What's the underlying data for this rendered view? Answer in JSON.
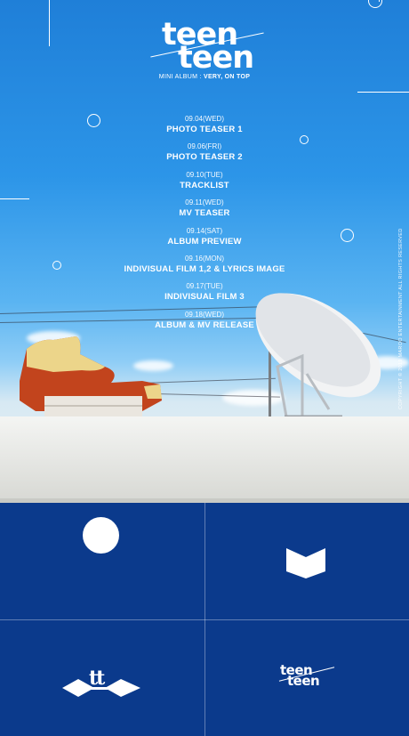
{
  "logo": {
    "line1": "teen",
    "line2": "teen"
  },
  "album": {
    "prefix": "MINI ALBUM : ",
    "title": "VERY, ON TOP"
  },
  "schedule": [
    {
      "date": "09.04(WED)",
      "title": "PHOTO TEASER 1"
    },
    {
      "date": "09.06(FRI)",
      "title": "PHOTO TEASER 2"
    },
    {
      "date": "09.10(TUE)",
      "title": "TRACKLIST"
    },
    {
      "date": "09.11(WED)",
      "title": "MV TEASER"
    },
    {
      "date": "09.14(SAT)",
      "title": "ALBUM PREVIEW"
    },
    {
      "date": "09.16(MON)",
      "title": "INDIVISUAL FILM 1,2 & LYRICS IMAGE"
    },
    {
      "date": "09.17(TUE)",
      "title": "INDIVISUAL FILM 3"
    },
    {
      "date": "09.18(WED)",
      "title": "ALBUM & MV RELEASE"
    }
  ],
  "copyright": "COPYRIGHT © 2019 MAROO ENTERTAINMENT ALL RIGHTS RESERVED",
  "grid": {
    "tiles": [
      {
        "icon": "circle-icon"
      },
      {
        "icon": "open-book-icon"
      },
      {
        "icon": "tt-logo-icon",
        "text": "tt"
      },
      {
        "icon": "teenteen-logo-icon",
        "line1": "teen",
        "line2": "teen"
      }
    ]
  },
  "colors": {
    "sky": "#2c95e8",
    "grid_bg": "#0b3a8c",
    "text": "#ffffff"
  }
}
